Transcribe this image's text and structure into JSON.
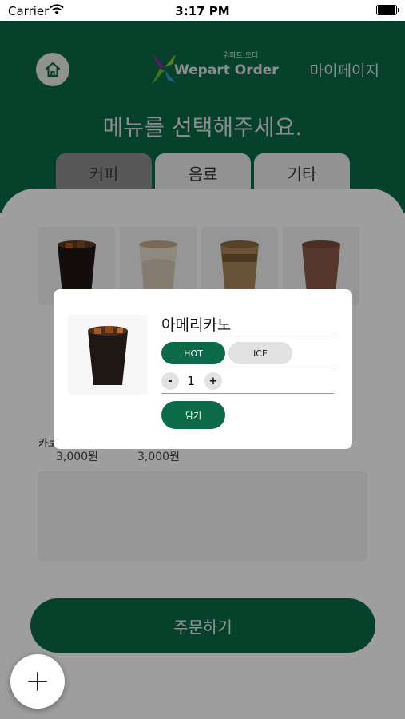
{
  "status_bar": {
    "carrier": "Carrier",
    "time": "3:17 PM"
  },
  "header": {
    "logo_small": "위파트 오더",
    "logo_main": "Wepart Order",
    "mypage": "마이페이지",
    "title": "메뉴를 선택해주세요."
  },
  "tabs": [
    {
      "label": "커피",
      "active": true
    },
    {
      "label": "음료",
      "active": false
    },
    {
      "label": "기타",
      "active": false
    }
  ],
  "menu": {
    "partial_label": "카로",
    "prices": [
      "3,000원",
      "3,000원"
    ]
  },
  "order_button": "주문하기",
  "modal": {
    "name": "아메리카노",
    "options": [
      "HOT",
      "ICE"
    ],
    "selected_option": "HOT",
    "quantity": "1",
    "minus": "-",
    "plus": "+",
    "add_label": "담기"
  },
  "colors": {
    "brand": "#0b6a47",
    "tab_inactive": "#ececec",
    "tab_active": "#8f8f8f"
  }
}
